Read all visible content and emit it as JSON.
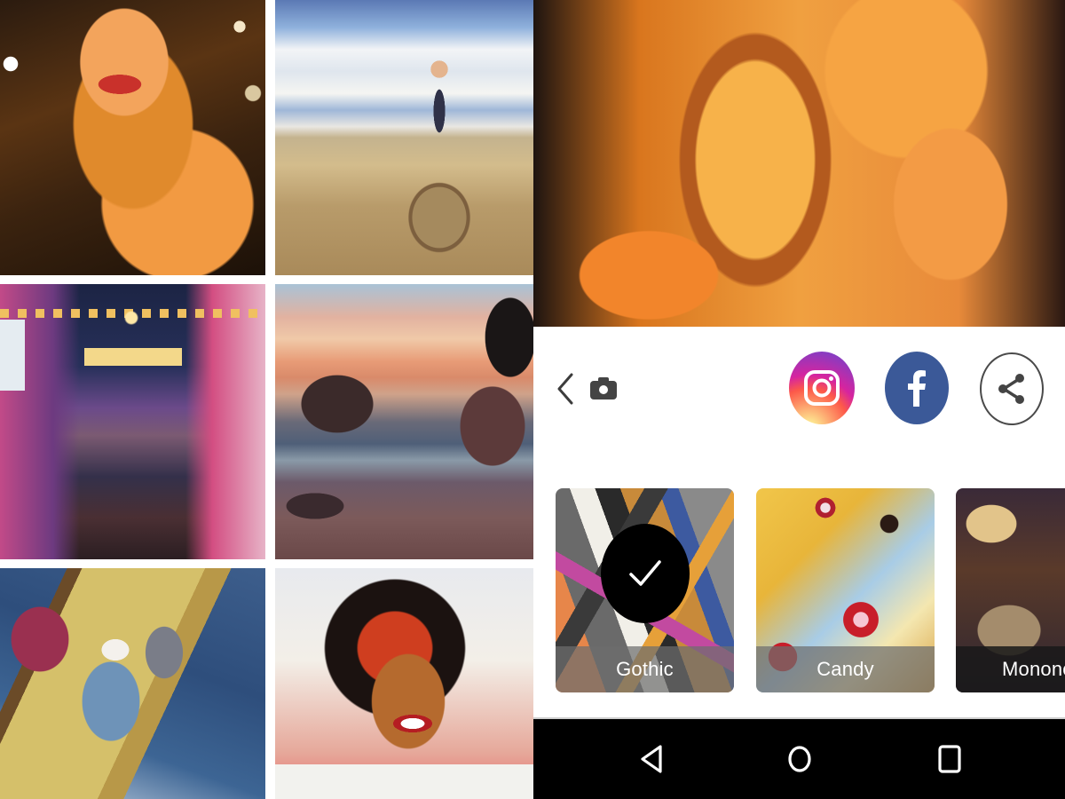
{
  "gallery": {
    "tiles": [
      {
        "subject": "woman with wavy hair painting"
      },
      {
        "subject": "man balancing on hay bale in field"
      },
      {
        "subject": "night street market with lanterns"
      },
      {
        "subject": "rocky shoreline at sunset"
      },
      {
        "subject": "people on a boat at sea"
      },
      {
        "subject": "smiling woman portrait"
      }
    ]
  },
  "phone": {
    "preview": {
      "subject": "stylized close-up of woman with wavy hair"
    },
    "toolbar": {
      "back_icon": "chevron-left-icon",
      "camera_icon": "camera-icon",
      "share_targets": [
        {
          "name": "Instagram",
          "icon": "instagram-icon",
          "color": "#d6249f"
        },
        {
          "name": "Facebook",
          "icon": "facebook-icon",
          "color": "#3b5998"
        },
        {
          "name": "Share",
          "icon": "share-icon",
          "color": "#4a4a4a"
        }
      ]
    },
    "filters": [
      {
        "label": "Gothic",
        "selected": true
      },
      {
        "label": "Candy",
        "selected": false
      },
      {
        "label": "Mononoke",
        "selected": false
      }
    ],
    "navbar": {
      "buttons": [
        "back",
        "home",
        "recent-apps"
      ]
    }
  }
}
